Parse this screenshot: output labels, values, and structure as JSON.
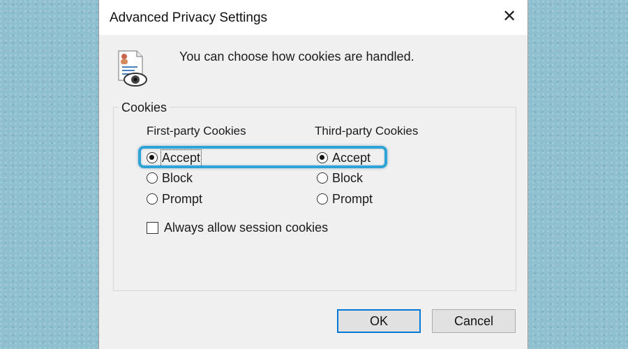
{
  "window": {
    "title": "Advanced Privacy Settings",
    "close_glyph": "✕"
  },
  "intro": {
    "text": "You can choose how cookies are handled.",
    "icon": "privacy-document-eye-icon"
  },
  "cookies": {
    "group_label": "Cookies",
    "first_party": {
      "heading": "First-party Cookies",
      "options": [
        "Accept",
        "Block",
        "Prompt"
      ],
      "selected": "Accept"
    },
    "third_party": {
      "heading": "Third-party Cookies",
      "options": [
        "Accept",
        "Block",
        "Prompt"
      ],
      "selected": "Accept"
    },
    "session": {
      "label": "Always allow session cookies",
      "checked": false
    }
  },
  "buttons": {
    "ok": "OK",
    "cancel": "Cancel"
  },
  "colors": {
    "highlight": "#2ea3d6",
    "default_button_border": "#0078d7",
    "background": "#8fc0cf"
  }
}
